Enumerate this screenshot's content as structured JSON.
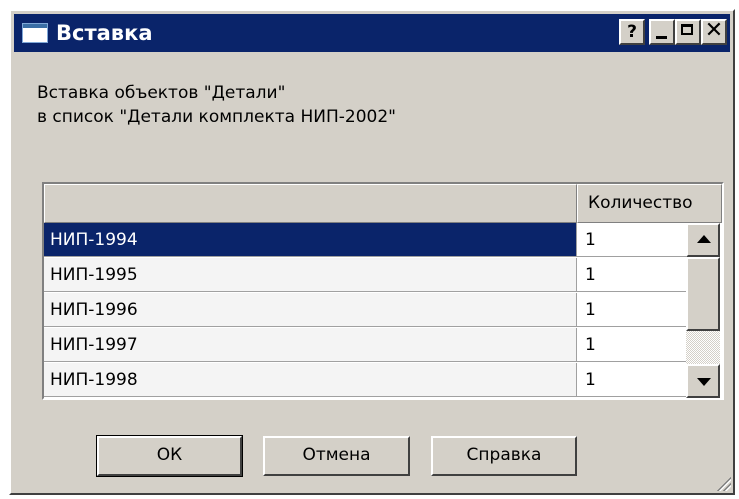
{
  "window": {
    "title": "Вставка",
    "title_buttons": {
      "help": "?",
      "close": "✕"
    }
  },
  "message": {
    "line1": "Вставка объектов \"Детали\"",
    "line2": "в список \"Детали комплекта НИП-2002\""
  },
  "table": {
    "columns": [
      "",
      "Количество"
    ],
    "rows": [
      {
        "name": "НИП-1994",
        "qty": "1",
        "selected": true
      },
      {
        "name": "НИП-1995",
        "qty": "1",
        "selected": false
      },
      {
        "name": "НИП-1996",
        "qty": "1",
        "selected": false
      },
      {
        "name": "НИП-1997",
        "qty": "1",
        "selected": false
      },
      {
        "name": "НИП-1998",
        "qty": "1",
        "selected": false
      }
    ]
  },
  "buttons": {
    "ok": "ОК",
    "cancel": "Отмена",
    "help": "Справка"
  },
  "colors": {
    "titlebar": "#0a246a",
    "selection": "#0a246a",
    "face": "#d4d0c8"
  }
}
